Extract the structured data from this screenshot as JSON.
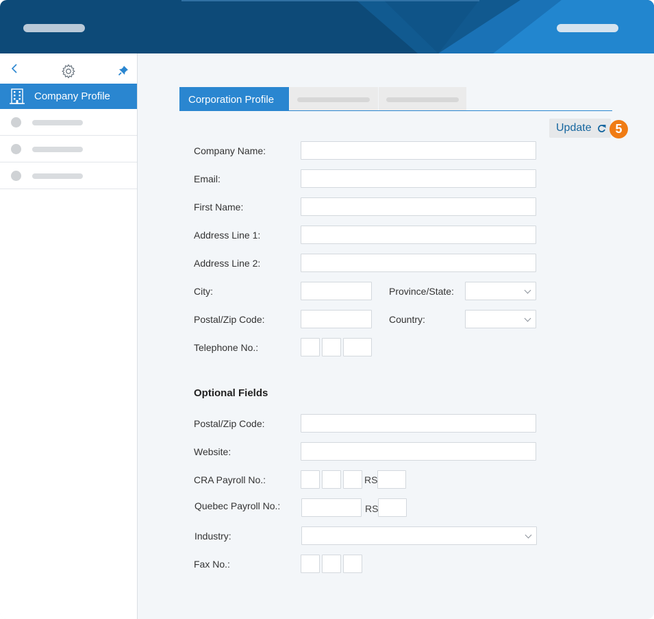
{
  "colors": {
    "header": "#0d4a78",
    "accent": "#2a86d0",
    "badge": "#f07c14",
    "link": "#15669f"
  },
  "sidebar": {
    "tools": [
      "back-chevron-icon",
      "gear-icon",
      "pin-icon"
    ],
    "active_item": {
      "icon": "building-icon",
      "label": "Company Profile"
    }
  },
  "tabs": [
    {
      "label": "Corporation Profile",
      "active": true
    }
  ],
  "update_button": {
    "label": "Update",
    "icon": "refresh-icon",
    "badge": "5"
  },
  "form": {
    "company_name": {
      "label": "Company Name:",
      "value": ""
    },
    "email": {
      "label": "Email:",
      "value": ""
    },
    "first_name": {
      "label": "First Name:",
      "value": ""
    },
    "address1": {
      "label": "Address Line 1:",
      "value": ""
    },
    "address2": {
      "label": "Address Line 2:",
      "value": ""
    },
    "city": {
      "label": "City:",
      "value": ""
    },
    "province": {
      "label": "Province/State:",
      "value": ""
    },
    "postal": {
      "label": "Postal/Zip Code:",
      "value": ""
    },
    "country": {
      "label": "Country:",
      "value": ""
    },
    "telephone": {
      "label": "Telephone No.:",
      "value": ""
    }
  },
  "optional": {
    "title": "Optional Fields",
    "postal": {
      "label": "Postal/Zip Code:",
      "value": ""
    },
    "website": {
      "label": "Website:",
      "value": ""
    },
    "cra": {
      "label": "CRA Payroll No.:",
      "rs": "RS"
    },
    "quebec": {
      "label": "Quebec Payroll No.:",
      "rs": "RS"
    },
    "industry": {
      "label": "Industry:",
      "value": ""
    },
    "fax": {
      "label": "Fax No.:"
    }
  }
}
